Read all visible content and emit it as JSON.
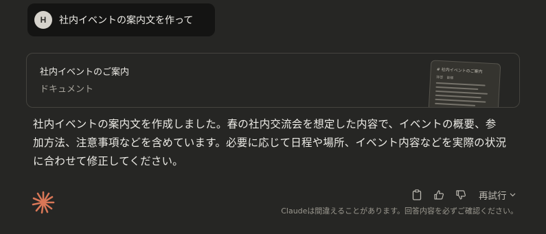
{
  "user_message": {
    "avatar_initial": "H",
    "text": "社内イベントの案内文を作って"
  },
  "artifact": {
    "title": "社内イベントのご案内",
    "type_label": "ドキュメント",
    "thumbnail": {
      "title": "# 社内イベントのご案内",
      "meta": "拝啓　皆様"
    }
  },
  "response": {
    "text": "社内イベントの案内文を作成しました。春の社内交流会を想定した内容で、イベントの概要、参加方法、注意事項などを含めています。必要に応じて日程や場所、イベント内容などを実際の状況に合わせて修正してください。"
  },
  "actions": {
    "copy_icon": "clipboard-icon",
    "thumbs_up_icon": "thumbs-up-icon",
    "thumbs_down_icon": "thumbs-down-icon",
    "retry_label": "再試行"
  },
  "disclaimer": "Claudeは間違えることがあります。回答内容を必ずご確認ください。",
  "colors": {
    "background": "#262624",
    "user_bubble": "#141413",
    "card_border": "#45443f",
    "logo_accent": "#d97757"
  }
}
